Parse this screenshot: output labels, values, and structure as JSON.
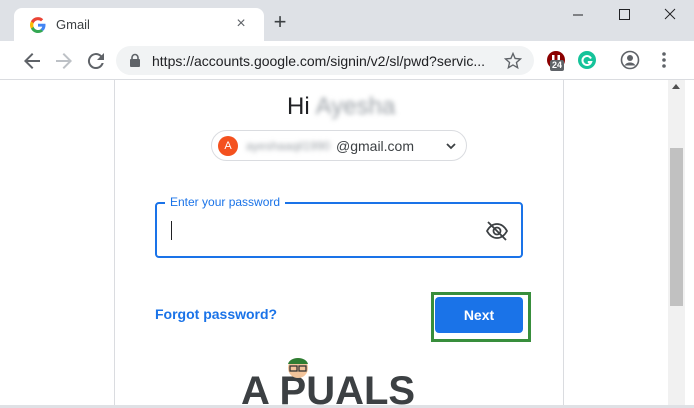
{
  "browser": {
    "tab_title": "Gmail",
    "tab_close": "×",
    "new_tab": "+",
    "window_min": "—",
    "window_max": "☐",
    "window_close": "✕",
    "url": "https://accounts.google.com/signin/v2/sl/pwd?servic...",
    "ext_badge": "24"
  },
  "signin": {
    "greeting": "Hi",
    "greeting_name": "Ayesha",
    "avatar_letter": "A",
    "email_user": "ayeshaaqil1990",
    "email_domain": "@gmail.com",
    "password_label": "Enter your password",
    "forgot_link": "Forgot password?",
    "next_button": "Next"
  },
  "watermark": {
    "text": "A PUALS"
  },
  "colors": {
    "accent": "#1a73e8",
    "highlight": "#388e3c",
    "avatar": "#f4511e"
  }
}
